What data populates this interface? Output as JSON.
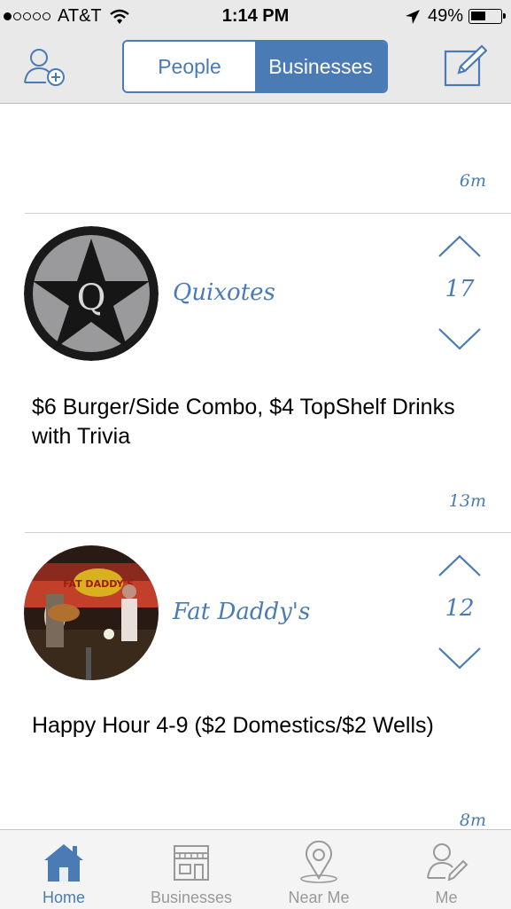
{
  "status_bar": {
    "carrier": "AT&T",
    "time": "1:14 PM",
    "battery": "49%",
    "signal_filled": 1,
    "signal_total": 5,
    "battery_level": 0.49
  },
  "nav": {
    "segments": [
      "People",
      "Businesses"
    ],
    "selected": "Businesses"
  },
  "feed": {
    "top_timestamp": "6m",
    "posts": [
      {
        "name": "Quixotes",
        "votes": "17",
        "deal": "$6 Burger/Side Combo, $4 TopShelf Drinks with Trivia",
        "timestamp": "13m"
      },
      {
        "name": "Fat Daddy's",
        "votes": "12",
        "deal": "Happy Hour 4-9 ($2 Domestics/$2 Wells)",
        "timestamp": "8m",
        "sign_text": "FAT DADDY'S"
      }
    ]
  },
  "tabs": [
    {
      "label": "Home",
      "icon": "home-icon",
      "active": true
    },
    {
      "label": "Businesses",
      "icon": "storefront-icon",
      "active": false
    },
    {
      "label": "Near Me",
      "icon": "map-pin-icon",
      "active": false
    },
    {
      "label": "Me",
      "icon": "user-edit-icon",
      "active": false
    }
  ],
  "colors": {
    "accent": "#4a7bb5",
    "bar_bg": "#e9e9ea",
    "tab_inactive": "#999999"
  }
}
